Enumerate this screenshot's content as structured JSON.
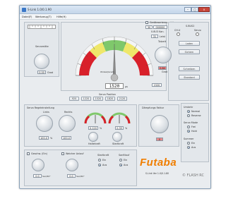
{
  "window": {
    "title": "S-Link 1.0/0.1.90"
  },
  "menu": [
    "Datei(F)",
    "Werkzeug(T)",
    "Hilfe(H)"
  ],
  "top_left": {
    "servomitte_label": "Servomitte",
    "servomitte_value": "0.00",
    "servomitte_unit": "Grad"
  },
  "meter": {
    "center_label": "Winkel(Grad)",
    "readout": "1520",
    "readout_unit": "µs"
  },
  "top_controls": {
    "checkbox_label": "Geräteseriennr. aktiv",
    "field1": "30",
    "field2": "000000",
    "kanal_label": "0.8U3 Kan.",
    "kanal_value": "31",
    "power_label": "Leist"
  },
  "right_top": {
    "header": "S.BUS2",
    "leds": [
      "CH.U",
      "Servo"
    ],
    "buttons": [
      "Laden",
      "Sichern",
      "Schreiben",
      "Standard"
    ]
  },
  "totzeit": {
    "label": "Totzeit",
    "value": "0.80",
    "unit": "Grad"
  },
  "servo_position": {
    "header": "Servo Position",
    "buttons": [
      "920",
      "1220",
      "1520",
      "1820",
      "2120"
    ],
    "value": "1520"
  },
  "regelstellung": {
    "header": "Servo Regeleinstellung",
    "left_label": "Links",
    "right_label": "Rechts",
    "left_value": "100.0",
    "right_value": "100.0",
    "unit": "%"
  },
  "haltekraft": {
    "label": "Haltekraft",
    "value": "0.120",
    "unit": "%"
  },
  "startkraft": {
    "label": "Startkraft",
    "value": "0.39",
    "unit": "%"
  },
  "daempfung": {
    "label": "Dämpfungs Faktor",
    "value": "0"
  },
  "umkehr": {
    "label": "Umkehr",
    "options": [
      "Normal",
      "Reverse"
    ],
    "selected": 0
  },
  "servo_mode": {
    "label": "Servo Mode",
    "options": [
      "Frei",
      "Hold"
    ],
    "selected": 1
  },
  "summer": {
    "label": "Summer",
    "options": [
      "Ein",
      "Aus"
    ],
    "selected": 1
  },
  "bottom": {
    "geschw_label": "Geschw. (Ein)",
    "geschw_value": "0.0",
    "geschw_unit": "Sec/60°",
    "weicher_label": "Weicher Anlauf",
    "weicher_value": "0.0",
    "weicher_unit": "Sec/60°",
    "startkraft2_label": "Startkraft",
    "sanftlauf_label": "Sanftlauf",
    "on_off": [
      "Ein",
      "Aus"
    ]
  },
  "brand": {
    "logo_text": "Futaba",
    "version": "S-Link Ver 1.0/0.1.80",
    "watermark": "© FLASH RC"
  },
  "colors": {
    "accent_red": "#d8202a",
    "logo_orange": "#f07e00",
    "gauge_green": "#7fc86b",
    "gauge_yellow": "#efe76a"
  }
}
